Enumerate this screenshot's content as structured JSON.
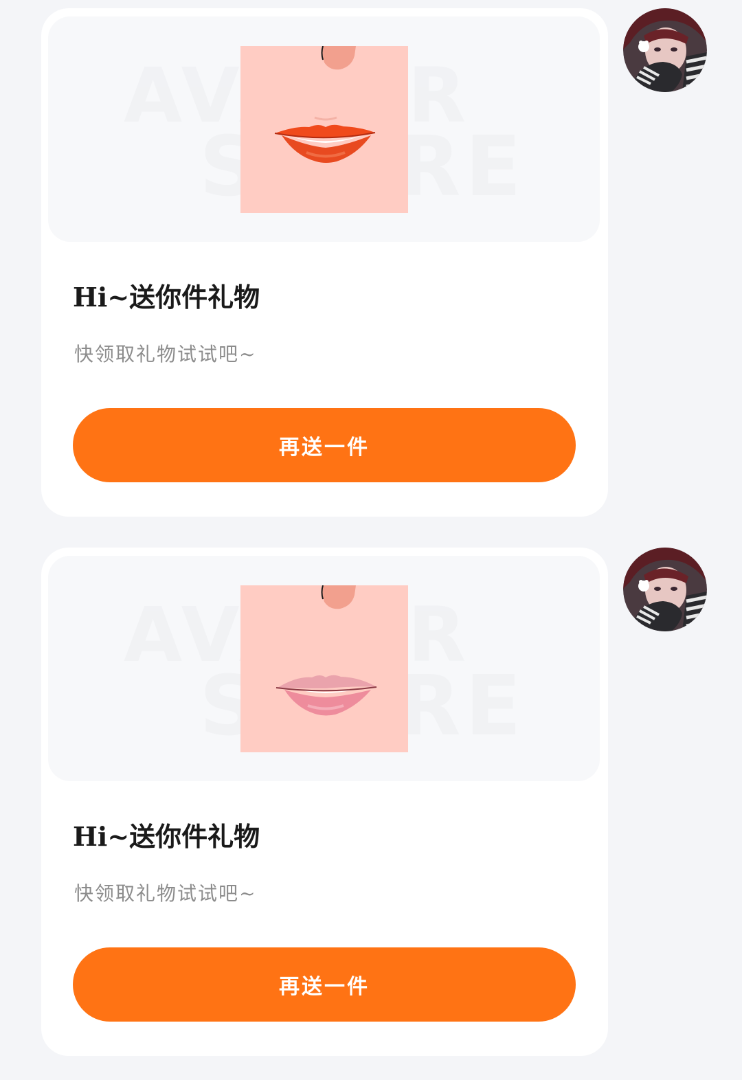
{
  "messages": [
    {
      "title": "Hi~送你件礼物",
      "subtitle": "快领取礼物试试吧~",
      "button_label": "再送一件",
      "item_icon": "lips-red-icon",
      "watermark_line1": "AVATAR",
      "watermark_line2": "STORE"
    },
    {
      "title": "Hi~送你件礼物",
      "subtitle": "快领取礼物试试吧~",
      "button_label": "再送一件",
      "item_icon": "lips-pink-icon",
      "watermark_line1": "AVATAR",
      "watermark_line2": "STORE"
    }
  ],
  "colors": {
    "background": "#f4f5f8",
    "card": "#ffffff",
    "accent": "#ff7314",
    "title": "#1a1a1a",
    "subtitle": "#8c8c8c",
    "skin": "#ffccc3",
    "lip_red": "#f04a1c",
    "lip_pink": "#f08fa0"
  }
}
